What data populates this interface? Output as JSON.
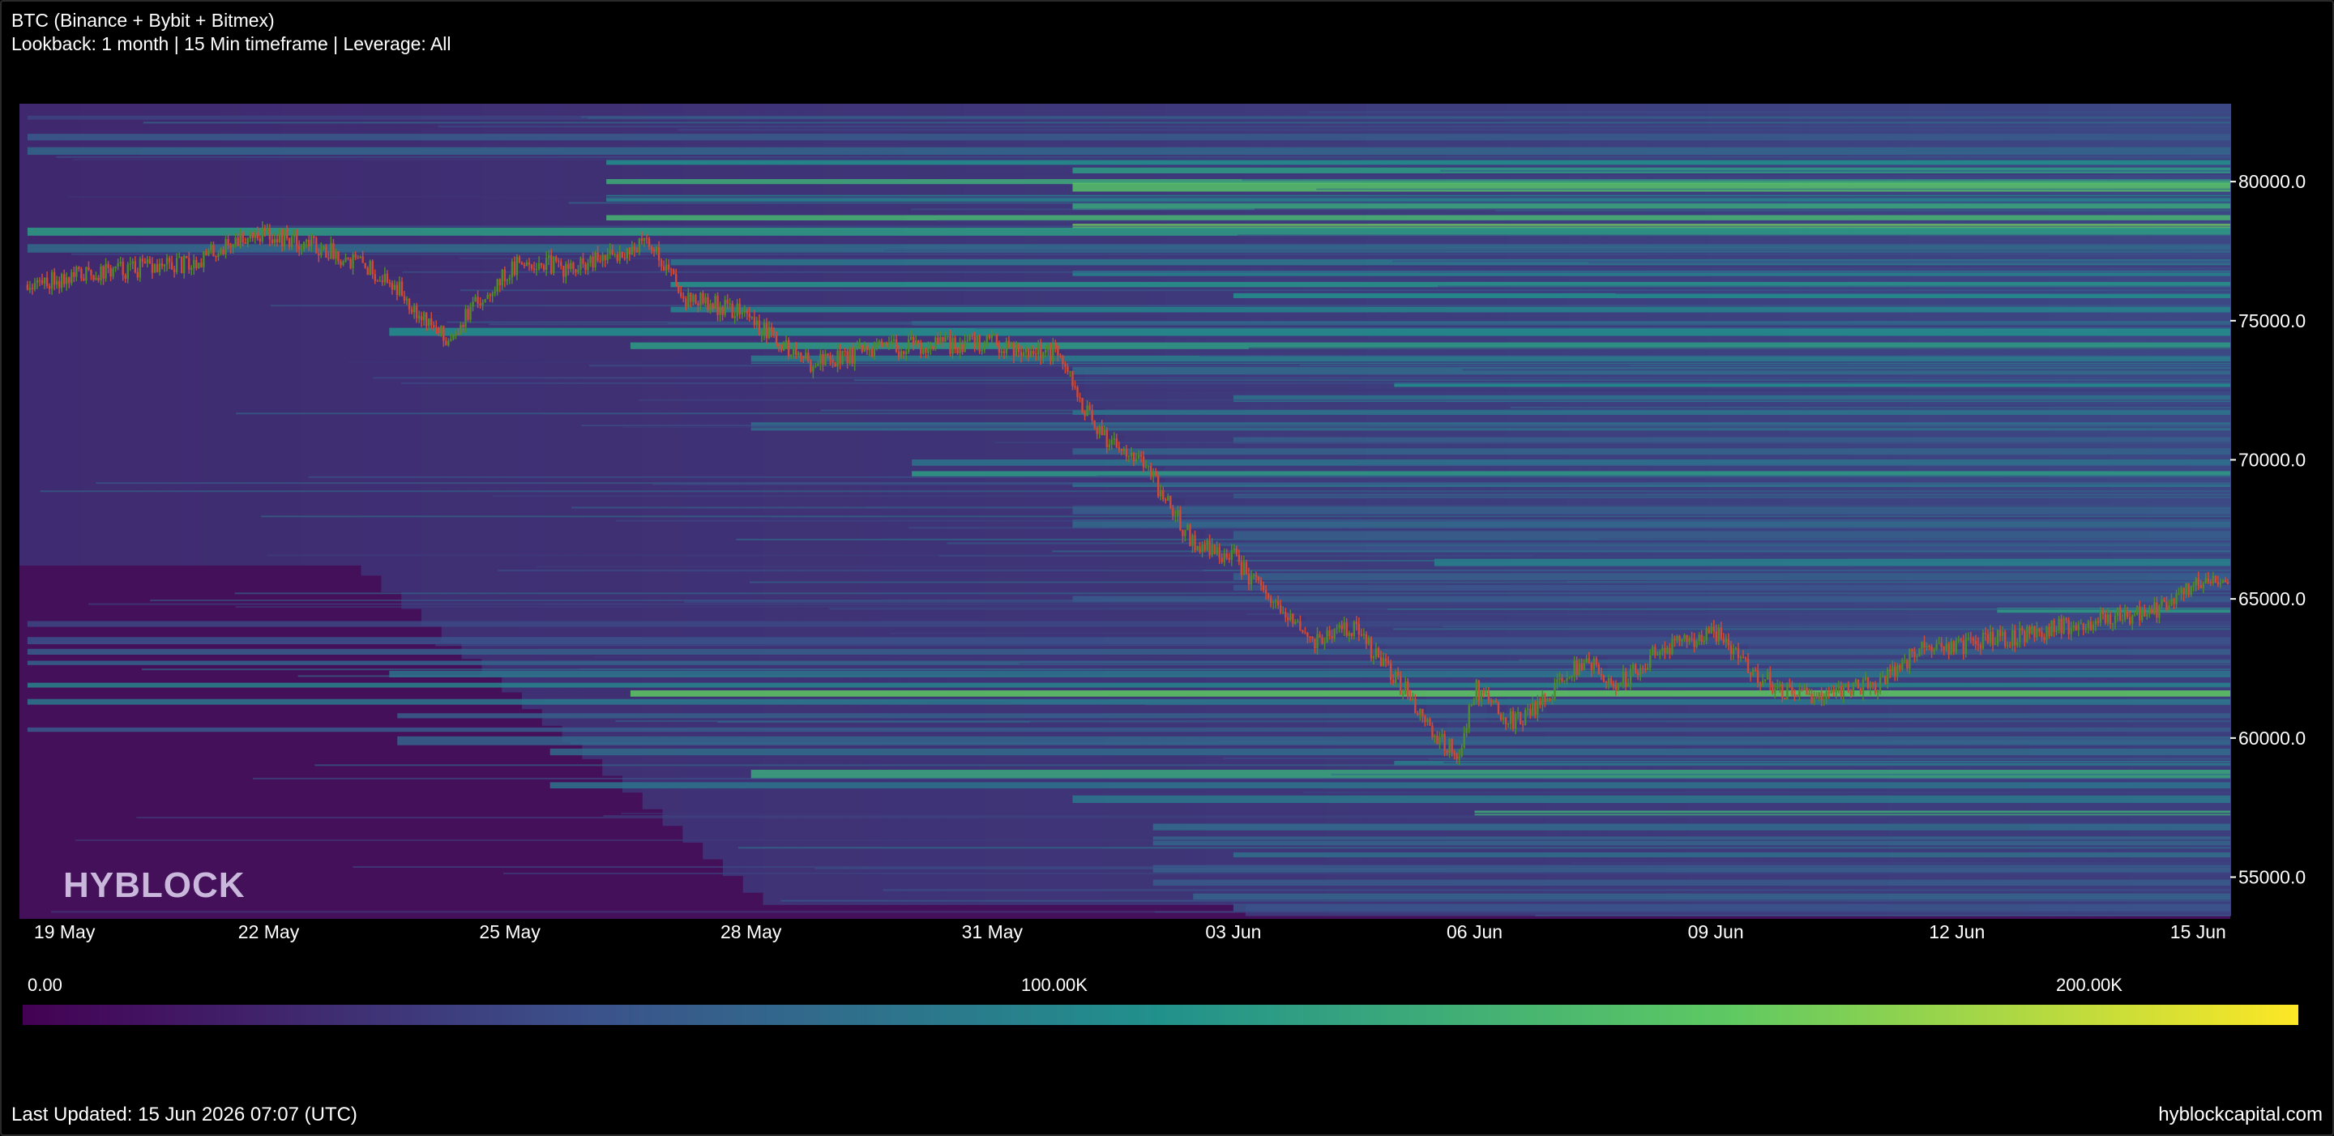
{
  "header": {
    "title": "BTC (Binance + Bybit + Bitmex)",
    "subtitle": "Lookback: 1 month | 15 Min timeframe | Leverage: All"
  },
  "watermark": "HYBLOCK",
  "footer": {
    "updated": "Last Updated: 15 Jun 2026 07:07 (UTC)",
    "site": "hyblockcapital.com"
  },
  "colorbar": {
    "min_label": "0.00",
    "mid_label": "100.00K",
    "max_label": "200.00K",
    "min": 0,
    "max": 240000,
    "stops": [
      "#440154",
      "#3b528b",
      "#21918c",
      "#5ec962",
      "#fde725"
    ]
  },
  "chart_data": {
    "type": "heatmap",
    "title": "BTC (Binance + Bybit + Bitmex)",
    "x_tick_labels": [
      "19 May",
      "22 May",
      "25 May",
      "28 May",
      "31 May",
      "03 Jun",
      "06 Jun",
      "09 Jun",
      "12 Jun",
      "15 Jun"
    ],
    "y_tick_labels": [
      "80000.0",
      "75000.0",
      "70000.0",
      "65000.0",
      "60000.0",
      "55000.0"
    ],
    "y_ticks": [
      80000,
      75000,
      70000,
      65000,
      60000,
      55000
    ],
    "ylim": [
      53500,
      82800
    ],
    "xlim_days": [
      -0.1,
      27.4
    ],
    "grid": false,
    "colorbar_position": "bottom",
    "series": [
      {
        "type": "candlestick-line",
        "x_days": [
          0,
          1,
          2,
          2.8,
          3.5,
          4.2,
          4.6,
          5.2,
          5.8,
          6.2,
          6.8,
          7.5,
          7.75,
          8.2,
          8.9,
          9.3,
          9.7,
          10.3,
          11.0,
          12.0,
          12.8,
          13.3,
          13.8,
          14.5,
          15.0,
          15.5,
          16.0,
          16.5,
          16.8,
          17.2,
          17.5,
          17.8,
          18.0,
          18.5,
          19.0,
          19.4,
          19.7,
          20.3,
          21.0,
          21.5,
          22.0,
          22.5,
          23.0,
          23.5,
          24.2,
          25.0,
          25.8,
          26.5,
          27.0,
          27.4
        ],
        "prices": [
          76300,
          76800,
          77000,
          78200,
          77800,
          77000,
          76200,
          74300,
          76300,
          77200,
          76800,
          77600,
          77800,
          75800,
          75300,
          74300,
          73500,
          73800,
          74100,
          74200,
          73800,
          71000,
          70200,
          67000,
          66500,
          64700,
          63500,
          64000,
          62800,
          61500,
          60200,
          59300,
          61800,
          60500,
          61800,
          62900,
          61700,
          63200,
          63800,
          62300,
          61400,
          61800,
          61900,
          63100,
          63400,
          63800,
          64300,
          64600,
          65600,
          65900
        ],
        "up_color": "#4f8a2c",
        "down_color": "#d04a36"
      }
    ]
  }
}
